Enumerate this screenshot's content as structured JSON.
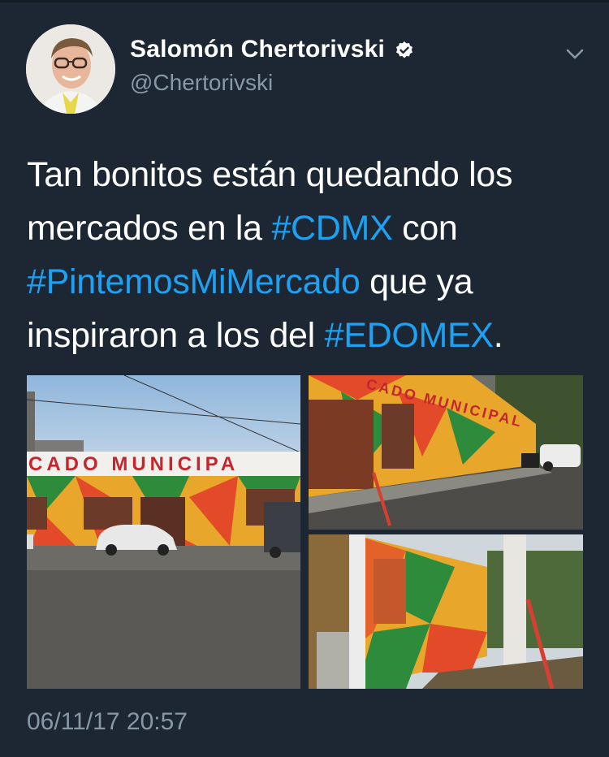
{
  "tweet": {
    "author": {
      "name": "Salomón Chertorivski",
      "handle": "@Chertorivski",
      "verified": true,
      "avatar_icon": "profile-photo"
    },
    "text_segments": [
      {
        "text": "Tan bonitos están quedando los mercados en la ",
        "type": "text"
      },
      {
        "text": "#CDMX",
        "type": "hashtag"
      },
      {
        "text": " con ",
        "type": "text"
      },
      {
        "text": "#PintemosMiMercado",
        "type": "hashtag"
      },
      {
        "text": " que ya inspiraron a los del ",
        "type": "text"
      },
      {
        "text": "#EDOMEX",
        "type": "hashtag"
      },
      {
        "text": ".",
        "type": "text"
      }
    ],
    "photos": [
      {
        "sign_text": "CADO MUNICIPA",
        "alt_icon": "market-facade-photo"
      },
      {
        "sign_text": "CADO MUNICIPAL",
        "alt_icon": "market-street-photo"
      },
      {
        "sign_text": "",
        "alt_icon": "market-side-photo"
      }
    ],
    "timestamp": "06/11/17 20:57",
    "menu_icon": "chevron-down-icon",
    "verified_icon": "verified-badge-icon"
  },
  "colors": {
    "background": "#1c2733",
    "text": "#ffffff",
    "secondary": "#8899a6",
    "link": "#1da1f2"
  }
}
